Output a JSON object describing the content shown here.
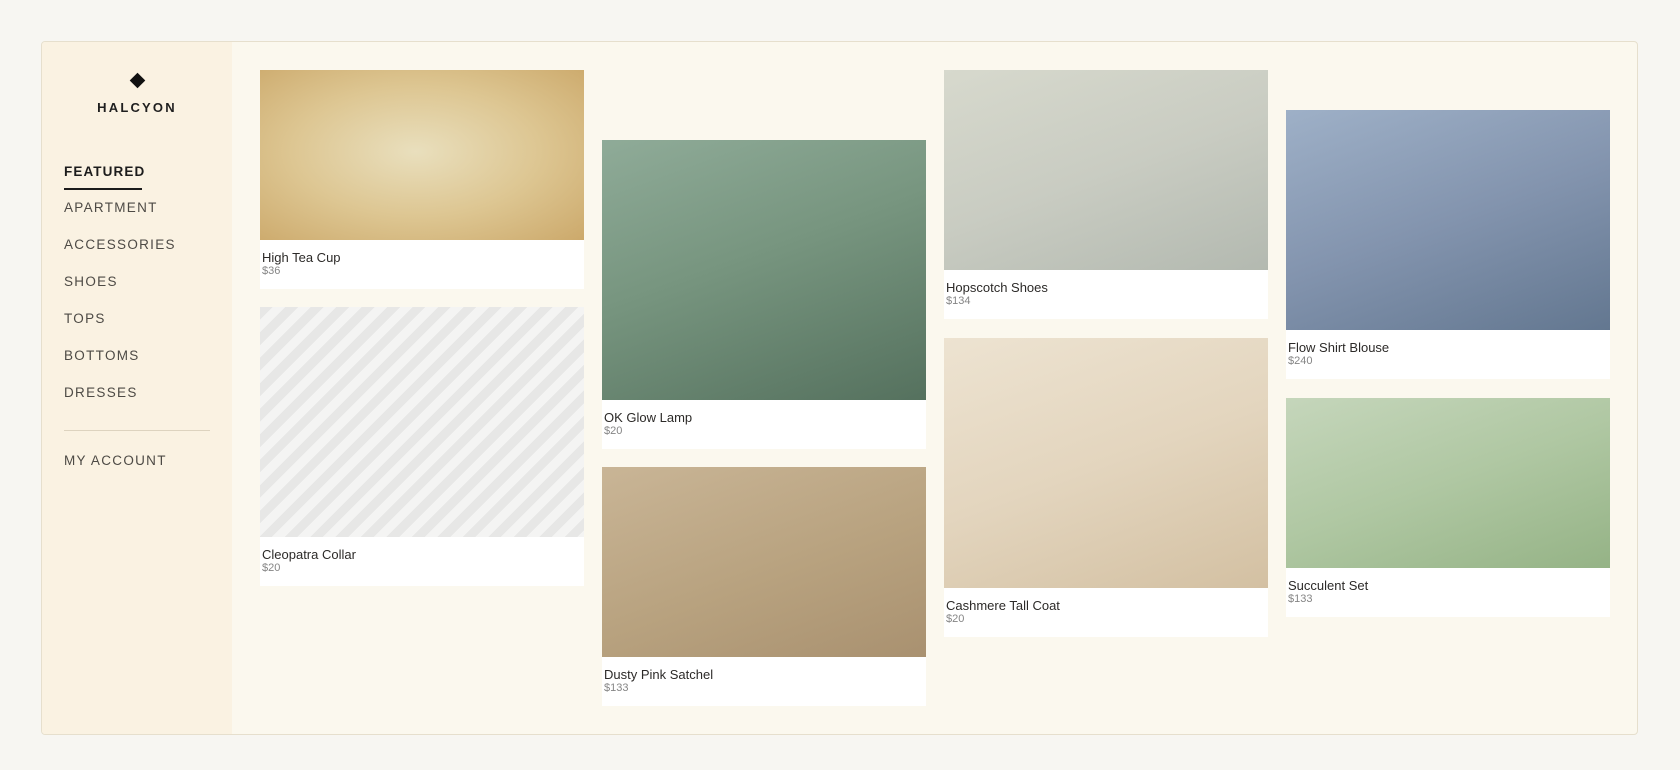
{
  "brand": {
    "name": "HALCYON"
  },
  "nav": {
    "items": [
      {
        "label": "FEATURED",
        "active": true
      },
      {
        "label": "APARTMENT"
      },
      {
        "label": "ACCESSORIES"
      },
      {
        "label": "SHOES"
      },
      {
        "label": "TOPS"
      },
      {
        "label": "BOTTOMS"
      },
      {
        "label": "DRESSES"
      }
    ],
    "account_label": "MY ACCOUNT"
  },
  "products": [
    {
      "title": "High Tea Cup",
      "price": "$36"
    },
    {
      "title": "Cleopatra Collar",
      "price": "$20"
    },
    {
      "title": "OK Glow Lamp",
      "price": "$20"
    },
    {
      "title": "Dusty Pink Satchel",
      "price": "$133"
    },
    {
      "title": "Hopscotch Shoes",
      "price": "$134"
    },
    {
      "title": "Cashmere Tall Coat",
      "price": "$20"
    },
    {
      "title": "Flow Shirt Blouse",
      "price": "$240"
    },
    {
      "title": "Succulent Set",
      "price": "$133"
    }
  ],
  "colors": {
    "background": "#f7f6f2",
    "panel": "#fbf8ee",
    "sidebar": "#faf2e2",
    "accent": "#1c1c1c"
  }
}
